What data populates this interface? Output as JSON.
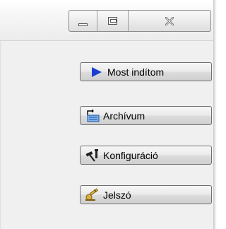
{
  "window": {
    "caption_buttons": [
      {
        "name": "minimize",
        "icon": "minimize-icon"
      },
      {
        "name": "maximize",
        "icon": "maximize-icon"
      },
      {
        "name": "close",
        "icon": "close-icon"
      }
    ]
  },
  "buttons": [
    {
      "label": "Most indítom",
      "icon": "play-icon",
      "color": "#1a3fd0"
    },
    {
      "label": "Archívum",
      "icon": "archive-icon",
      "color": "#3a7dd8"
    },
    {
      "label": "Konfiguráció",
      "icon": "tools-icon",
      "color": "#222222"
    },
    {
      "label": "Jelszó",
      "icon": "key-icon",
      "color": "#c9a227"
    }
  ]
}
